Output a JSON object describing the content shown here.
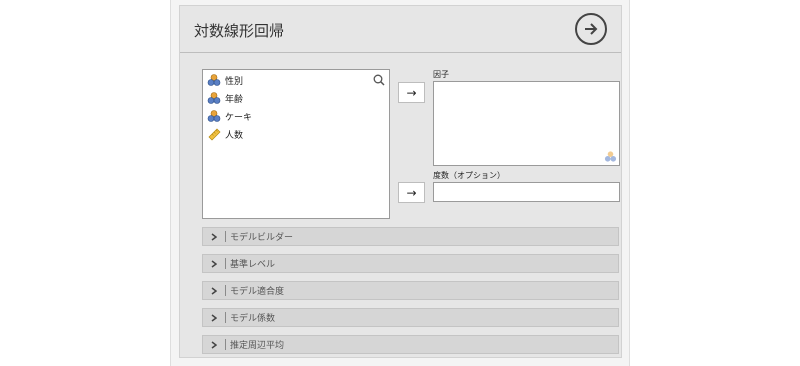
{
  "panel": {
    "title": "対数線形回帰",
    "go_icon": "arrow-right-circle-icon"
  },
  "variables": [
    {
      "label": "性別",
      "icon": "nominal-variable-icon"
    },
    {
      "label": "年齢",
      "icon": "nominal-variable-icon"
    },
    {
      "label": "ケーキ",
      "icon": "nominal-variable-icon"
    },
    {
      "label": "人数",
      "icon": "continuous-variable-icon"
    }
  ],
  "factor": {
    "label": "因子",
    "move_label": "→"
  },
  "degree": {
    "label": "度数（オプション）",
    "move_label": "→"
  },
  "sections": [
    {
      "label": "モデルビルダー"
    },
    {
      "label": "基準レベル"
    },
    {
      "label": "モデル適合度"
    },
    {
      "label": "モデル係数"
    },
    {
      "label": "推定周辺平均"
    }
  ],
  "colors": {
    "nominal_orange": "#e8a33a",
    "nominal_blue": "#5a7fc4",
    "continuous_yellow": "#f0c040"
  }
}
